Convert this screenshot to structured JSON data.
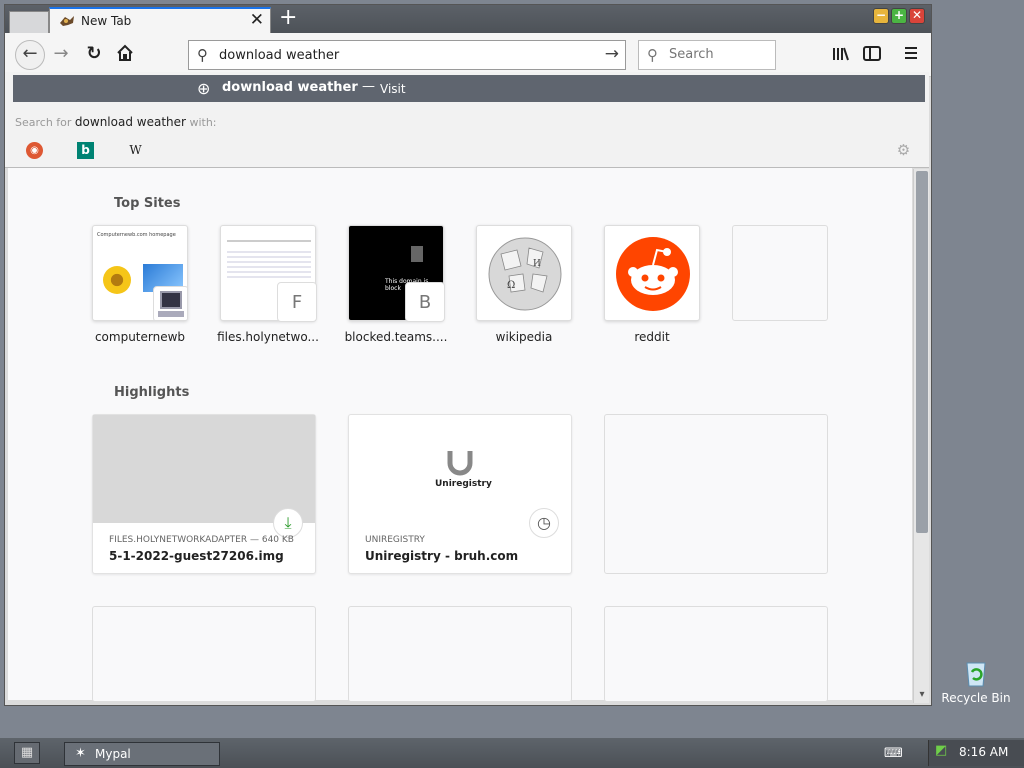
{
  "browser": {
    "tab_title": "New Tab",
    "tab_close": "✕",
    "new_tab": "+",
    "address_value": "download weather",
    "search_placeholder": "Search"
  },
  "window_controls": {
    "minimize": "−",
    "maximize": "+",
    "close": "✕"
  },
  "autocomplete": {
    "suggestion_term": "download weather",
    "suggestion_dash": "—",
    "suggestion_action": "Visit",
    "search_for_prefix": "Search for",
    "search_for_term": "download weather",
    "search_for_suffix": "with:",
    "engines": [
      "duckduckgo-icon",
      "bing-icon",
      "wikipedia-icon"
    ]
  },
  "top_sites": {
    "heading": "Top Sites",
    "items": [
      {
        "label": "computernewb",
        "badge": ""
      },
      {
        "label": "files.holynetwo...",
        "badge": "F"
      },
      {
        "label": "blocked.teams....",
        "badge": "B"
      },
      {
        "label": "wikipedia",
        "badge": ""
      },
      {
        "label": "reddit",
        "badge": ""
      }
    ]
  },
  "highlights": {
    "heading": "Highlights",
    "items": [
      {
        "source": "FILES.HOLYNETWORKADAPTER — 640 KB",
        "title": "5-1-2022-guest27206.img",
        "icon": "download-icon"
      },
      {
        "source": "UNIREGISTRY",
        "title": "Uniregistry - bruh.com",
        "icon": "clock-icon",
        "logo_text": "Uniregistry"
      }
    ]
  },
  "thumbnails": {
    "computernewb_heading": "Computernewb.com homepage",
    "blocked_text": "This domain is block"
  },
  "desktop": {
    "recycle_bin": "Recycle Bin"
  },
  "taskbar": {
    "item_label": "Mypal",
    "clock": "8:16 AM"
  },
  "colors": {
    "accent": "#1a73e8",
    "reddit": "#ff4500",
    "download": "#2e9c2e",
    "suggest_bar": "#5f656f"
  }
}
